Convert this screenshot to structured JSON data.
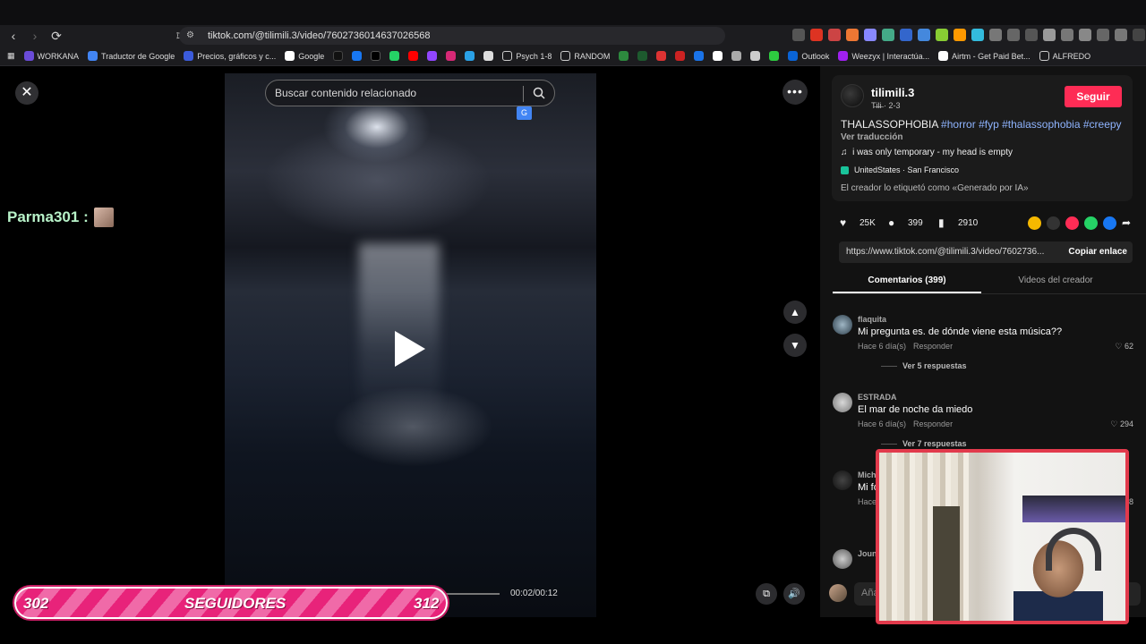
{
  "browser": {
    "url": "tiktok.com/@tilimili.3/video/7602736014637026568",
    "bookmarks": [
      "WORKANA",
      "Traductor de Google",
      "Precios, gráficos y c...",
      "Google",
      "Psych 1-8",
      "RANDOM",
      "Outlook",
      "Weezyx | Interactúa...",
      "Airtm - Get Paid Bet...",
      "ALFREDO"
    ]
  },
  "video": {
    "search_placeholder": "Buscar contenido relacionado",
    "time": "00:02/00:12",
    "chat_user": "Parma301 :"
  },
  "overlay": {
    "followers_left": "302",
    "followers_label": "SEGUIDORES",
    "followers_right": "312"
  },
  "creator": {
    "username": "tilimili.3",
    "subtitle": "T̶i̶l̶i̶ · 2-3",
    "follow_label": "Seguir",
    "description_text": "THALASSOPHOBIA",
    "tags": [
      "#horror",
      "#fyp",
      "#thalassophobia",
      "#creepy"
    ],
    "see_translation": "Ver traducción",
    "music": "i was only temporary - my head is empty",
    "location": "UnitedStates · San Francisco",
    "ai_label": "El creador lo etiquetó como «Generado por IA»"
  },
  "stats": {
    "likes": "25K",
    "comments": "399",
    "saves": "2910"
  },
  "share": {
    "link": "https://www.tiktok.com/@tilimili.3/video/7602736...",
    "copy_label": "Copiar enlace"
  },
  "tabs": {
    "comments": "Comentarios (399)",
    "videos": "Videos del creador"
  },
  "comments": [
    {
      "user": "flaquita",
      "text": "Mi pregunta es. de dónde viene esta música??",
      "time": "Hace 6 día(s)",
      "reply": "Responder",
      "likes": "62",
      "replies": "Ver 5 respuestas"
    },
    {
      "user": "ESTRADA",
      "text": "El mar de noche da miedo",
      "time": "Hace 6 día(s)",
      "reply": "Responder",
      "likes": "294",
      "replies": "Ver 7 respuestas"
    },
    {
      "user": "Mich",
      "text": "Mi fo",
      "time": "Hace",
      "reply": "",
      "likes": "8",
      "replies": ""
    },
    {
      "user": "Joun",
      "text": "",
      "time": "",
      "reply": "",
      "likes": "",
      "replies": ""
    }
  ],
  "add_comment_placeholder": "Aña"
}
